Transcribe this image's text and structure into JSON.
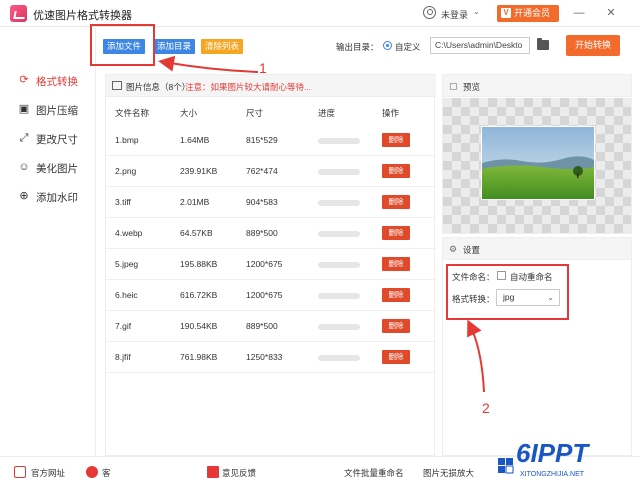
{
  "app": {
    "title": "优速图片格式转换器"
  },
  "titlebar": {
    "login": "未登录",
    "login_chevron": "⌄",
    "vip": "开通会员",
    "vip_icon": "V",
    "minimize": "—",
    "close": "✕"
  },
  "sidebar": {
    "items": [
      {
        "label": "格式转换",
        "icon": "⟳",
        "active": true
      },
      {
        "label": "图片压缩",
        "icon": "▣",
        "active": false
      },
      {
        "label": "更改尺寸",
        "icon": "⤢",
        "active": false
      },
      {
        "label": "美化图片",
        "icon": "☺",
        "active": false
      },
      {
        "label": "添加水印",
        "icon": "⊕",
        "active": false
      }
    ]
  },
  "toolbar": {
    "add_file": "添加文件",
    "add_folder": "添加目录",
    "clear_list": "清除列表",
    "output_label": "输出目录：",
    "custom_label": "自定义",
    "output_path": "C:\\Users\\admin\\Deskto",
    "start": "开始转换"
  },
  "list": {
    "title": "图片信息（8个）",
    "note": "注意：如果图片较大请耐心等待...",
    "columns": [
      "文件名称",
      "大小",
      "尺寸",
      "进度",
      "操作"
    ],
    "delete_label": "删除",
    "rows": [
      {
        "name": "1.bmp",
        "size": "1.64MB",
        "dim": "815*529"
      },
      {
        "name": "2.png",
        "size": "239.91KB",
        "dim": "762*474"
      },
      {
        "name": "3.tiff",
        "size": "2.01MB",
        "dim": "904*583"
      },
      {
        "name": "4.webp",
        "size": "64.57KB",
        "dim": "889*500"
      },
      {
        "name": "5.jpeg",
        "size": "195.88KB",
        "dim": "1200*675"
      },
      {
        "name": "6.heic",
        "size": "616.72KB",
        "dim": "1200*675"
      },
      {
        "name": "7.gif",
        "size": "190.54KB",
        "dim": "889*500"
      },
      {
        "name": "8.jfif",
        "size": "761.98KB",
        "dim": "1250*833"
      }
    ]
  },
  "preview": {
    "title": "预览"
  },
  "settings": {
    "title": "设置",
    "naming_label": "文件命名：",
    "auto_rename": "自动重命名",
    "format_label": "格式转换：",
    "format_value": "jpg",
    "format_chevron": "⌄"
  },
  "annotations": {
    "one": "1",
    "two": "2"
  },
  "footer": {
    "website": "官方网址",
    "support": "客",
    "feedback": "意见反馈",
    "batch_rename": "文件批量重命名",
    "lossless": "图片无损放大"
  },
  "watermark": {
    "brand": "6IPPT",
    "url": "XITONGZHIJIA.NET"
  },
  "colors": {
    "accent": "#e53935",
    "blue": "#3d86e5",
    "orange": "#f26b2d",
    "yellow": "#f5a623"
  }
}
